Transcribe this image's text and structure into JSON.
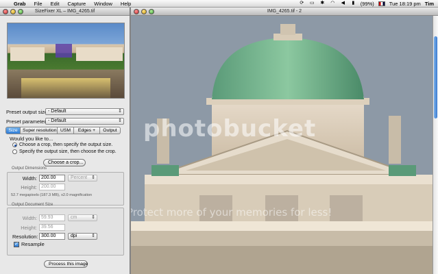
{
  "menubar": {
    "app": "Grab",
    "items": [
      "File",
      "Edit",
      "Capture",
      "Window",
      "Help"
    ],
    "battery": "(99%)",
    "clock": "Tue 18:19 pm",
    "user": "Tim"
  },
  "panel": {
    "title": "SizeFixer XL – IMG_4265.tif",
    "preset_output_label": "Preset output size:",
    "preset_output_value": "- Default",
    "preset_params_label": "Preset parameters:",
    "preset_params_value": "- Default",
    "tabs": [
      {
        "label": "Size",
        "active": true
      },
      {
        "label": "Super resolution",
        "active": false
      },
      {
        "label": "USM",
        "active": false
      },
      {
        "label": "Edges +",
        "active": false
      },
      {
        "label": "Output",
        "active": false
      }
    ],
    "would_you_like": "Would you like to...",
    "radio_crop": "Choose a crop, then specify the output size.",
    "radio_output": "Specify the output size, then choose the crop.",
    "choose_crop_button": "Choose a crop...",
    "output_dimensions_title": "Output Dimensions",
    "width_label": "Width:",
    "width_value": "200.00",
    "height_label": "Height:",
    "height_value": "200.00",
    "unit_value": "Percent",
    "megapixels_note": "52.7 megapixels (187.3 MB), x2.0 magnification",
    "output_doc_title": "Output Document Size",
    "doc_width_label": "Width:",
    "doc_width_value": "59.93",
    "doc_height_label": "Height:",
    "doc_height_value": "39.56",
    "doc_unit": "cm",
    "resolution_label": "Resolution:",
    "resolution_value": "300.00",
    "resolution_unit": "dpi",
    "resample_label": "Resample",
    "process_button": "Process this image"
  },
  "imagewin": {
    "title": "IMG_4265.tif - 2"
  },
  "watermark": {
    "main": "photobucket",
    "sub": "Protect more of your memories for less!"
  }
}
